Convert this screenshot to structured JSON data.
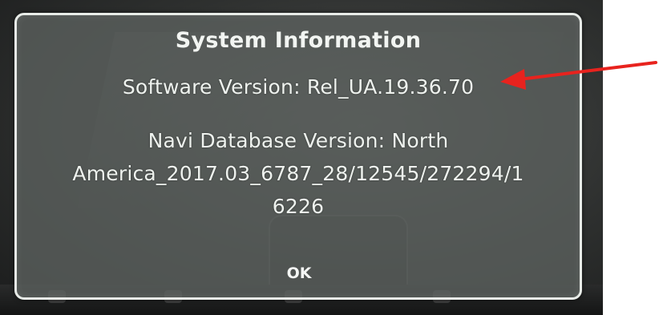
{
  "dialog": {
    "title": "System Information",
    "software_version": "Software Version: Rel_UA.19.36.70",
    "navi_line_1": "Navi Database Version: North",
    "navi_line_2": "America_2017.03_6787_28/12545/272294/1",
    "navi_line_3": "6226",
    "ok_label": "OK"
  },
  "annotation": {
    "arrow_color": "#e8231e"
  }
}
